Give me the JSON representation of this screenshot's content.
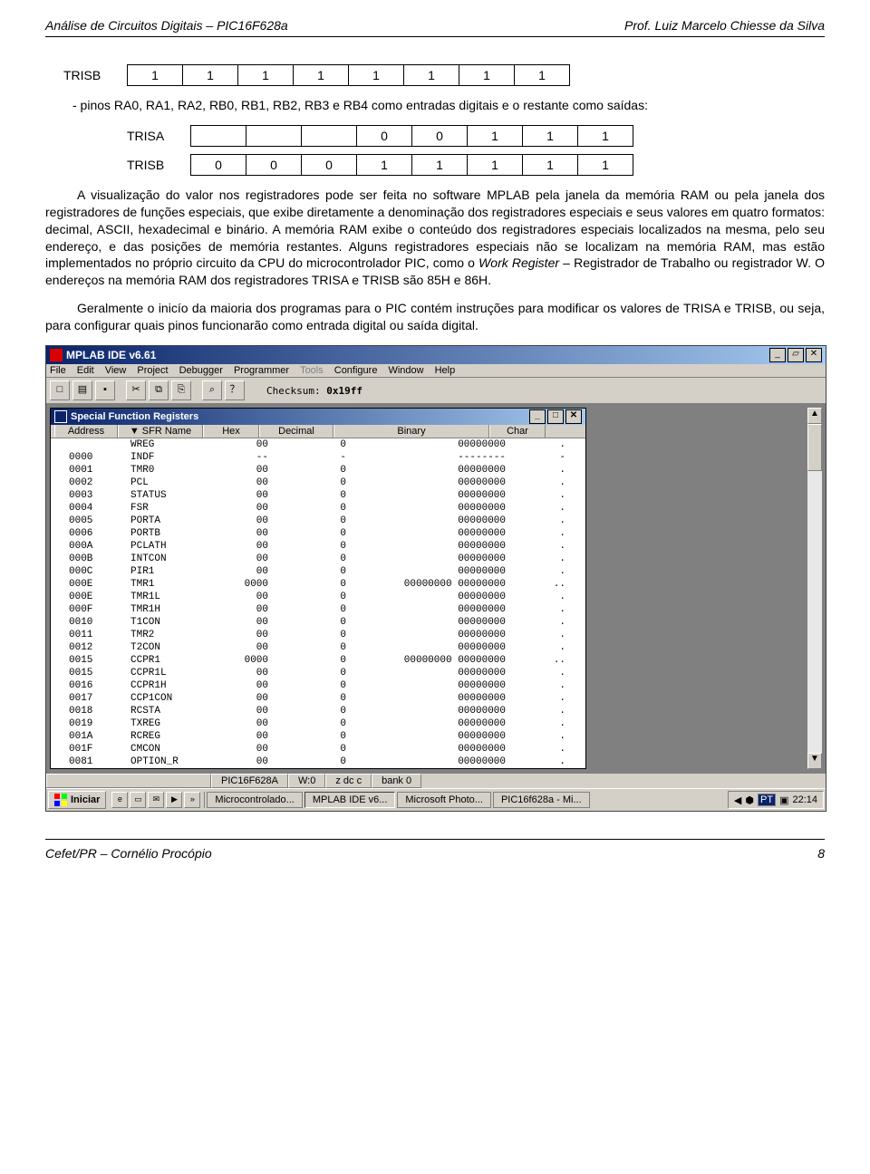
{
  "header": {
    "left": "Análise de Circuitos Digitais – PIC16F628a",
    "right": "Prof. Luiz Marcelo Chiesse da Silva"
  },
  "registers": {
    "trisb1_label": "TRISB",
    "trisb1_cells": [
      "1",
      "1",
      "1",
      "1",
      "1",
      "1",
      "1",
      "1"
    ],
    "trisa_label": "TRISA",
    "trisa_cells": [
      "",
      "",
      "",
      "0",
      "0",
      "1",
      "1",
      "1"
    ],
    "trisb2_label": "TRISB",
    "trisb2_cells": [
      "0",
      "0",
      "0",
      "1",
      "1",
      "1",
      "1",
      "1"
    ]
  },
  "body": {
    "p1": "- pinos RA0, RA1, RA2, RB0, RB1, RB2, RB3 e RB4 como entradas digitais e o restante como saídas:",
    "p2a": "A visualização do valor nos registradores pode ser feita no software MPLAB pela janela da memória RAM ou pela janela dos registradores de funções especiais, que exibe diretamente a denominação dos registradores especiais e seus valores em quatro formatos: decimal, ASCII, hexadecimal e binário. A memória RAM exibe o conteúdo dos registradores especiais localizados na mesma, pelo seu endereço, e das posições de memória restantes. Alguns registradores especiais não se localizam na memória RAM, mas estão implementados no próprio circuito da CPU do microcontrolador PIC, como o ",
    "p2_work": "Work Register",
    "p2b": " – Registrador de Trabalho ou registrador W. O endereços na memória RAM dos registradores TRISA e TRISB são 85H e 86H.",
    "p3": "Geralmente o inicío da maioria dos programas para o PIC contém instruções para modificar os valores de TRISA e TRISB, ou seja, para configurar quais pinos funcionarão como entrada digital ou saída digital."
  },
  "mplab": {
    "title": "MPLAB IDE v6.61",
    "menus": [
      "File",
      "Edit",
      "View",
      "Project",
      "Debugger",
      "Programmer",
      "Tools",
      "Configure",
      "Window",
      "Help"
    ],
    "menu_disabled_index": 7,
    "toolbar_icons": [
      "□",
      "▤",
      "▪",
      "✂",
      "⧉",
      "⎘",
      "⌕",
      "？"
    ],
    "checksum_label": "Checksum:",
    "checksum_value": "0x19ff",
    "sfr_title": "Special Function Registers",
    "sfr_headers": [
      "Address",
      "SFR Name",
      "Hex",
      "Decimal",
      "Binary",
      "Char"
    ],
    "sfr_rows": [
      {
        "addr": "",
        "name": "WREG",
        "hex": "00",
        "dec": "0",
        "bin": "00000000",
        "char": "."
      },
      {
        "addr": "0000",
        "name": "INDF",
        "hex": "--",
        "dec": "-",
        "bin": "--------",
        "char": "-"
      },
      {
        "addr": "0001",
        "name": "TMR0",
        "hex": "00",
        "dec": "0",
        "bin": "00000000",
        "char": "."
      },
      {
        "addr": "0002",
        "name": "PCL",
        "hex": "00",
        "dec": "0",
        "bin": "00000000",
        "char": "."
      },
      {
        "addr": "0003",
        "name": "STATUS",
        "hex": "00",
        "dec": "0",
        "bin": "00000000",
        "char": "."
      },
      {
        "addr": "0004",
        "name": "FSR",
        "hex": "00",
        "dec": "0",
        "bin": "00000000",
        "char": "."
      },
      {
        "addr": "0005",
        "name": "PORTA",
        "hex": "00",
        "dec": "0",
        "bin": "00000000",
        "char": "."
      },
      {
        "addr": "0006",
        "name": "PORTB",
        "hex": "00",
        "dec": "0",
        "bin": "00000000",
        "char": "."
      },
      {
        "addr": "000A",
        "name": "PCLATH",
        "hex": "00",
        "dec": "0",
        "bin": "00000000",
        "char": "."
      },
      {
        "addr": "000B",
        "name": "INTCON",
        "hex": "00",
        "dec": "0",
        "bin": "00000000",
        "char": "."
      },
      {
        "addr": "000C",
        "name": "PIR1",
        "hex": "00",
        "dec": "0",
        "bin": "00000000",
        "char": "."
      },
      {
        "addr": "000E",
        "name": "TMR1",
        "hex": "0000",
        "dec": "0",
        "bin": "00000000 00000000",
        "char": ".."
      },
      {
        "addr": "000E",
        "name": "TMR1L",
        "hex": "00",
        "dec": "0",
        "bin": "00000000",
        "char": "."
      },
      {
        "addr": "000F",
        "name": "TMR1H",
        "hex": "00",
        "dec": "0",
        "bin": "00000000",
        "char": "."
      },
      {
        "addr": "0010",
        "name": "T1CON",
        "hex": "00",
        "dec": "0",
        "bin": "00000000",
        "char": "."
      },
      {
        "addr": "0011",
        "name": "TMR2",
        "hex": "00",
        "dec": "0",
        "bin": "00000000",
        "char": "."
      },
      {
        "addr": "0012",
        "name": "T2CON",
        "hex": "00",
        "dec": "0",
        "bin": "00000000",
        "char": "."
      },
      {
        "addr": "0015",
        "name": "CCPR1",
        "hex": "0000",
        "dec": "0",
        "bin": "00000000 00000000",
        "char": ".."
      },
      {
        "addr": "0015",
        "name": "CCPR1L",
        "hex": "00",
        "dec": "0",
        "bin": "00000000",
        "char": "."
      },
      {
        "addr": "0016",
        "name": "CCPR1H",
        "hex": "00",
        "dec": "0",
        "bin": "00000000",
        "char": "."
      },
      {
        "addr": "0017",
        "name": "CCP1CON",
        "hex": "00",
        "dec": "0",
        "bin": "00000000",
        "char": "."
      },
      {
        "addr": "0018",
        "name": "RCSTA",
        "hex": "00",
        "dec": "0",
        "bin": "00000000",
        "char": "."
      },
      {
        "addr": "0019",
        "name": "TXREG",
        "hex": "00",
        "dec": "0",
        "bin": "00000000",
        "char": "."
      },
      {
        "addr": "001A",
        "name": "RCREG",
        "hex": "00",
        "dec": "0",
        "bin": "00000000",
        "char": "."
      },
      {
        "addr": "001F",
        "name": "CMCON",
        "hex": "00",
        "dec": "0",
        "bin": "00000000",
        "char": "."
      },
      {
        "addr": "0081",
        "name": "OPTION_R",
        "hex": "00",
        "dec": "0",
        "bin": "00000000",
        "char": "."
      }
    ],
    "status": {
      "chip": "PIC16F628A",
      "w": "W:0",
      "zdc": "z dc c",
      "bank": "bank 0"
    },
    "taskbar": {
      "start": "Iniciar",
      "tasks": [
        {
          "label": "Microcontrolado...",
          "active": false
        },
        {
          "label": "MPLAB IDE v6...",
          "active": true
        },
        {
          "label": "Microsoft Photo...",
          "active": false
        },
        {
          "label": "PIC16f628a - Mi...",
          "active": false
        }
      ],
      "tray_lang": "PT",
      "clock": "22:14"
    }
  },
  "footer": {
    "left": "Cefet/PR – Cornélio Procópio",
    "right": "8"
  }
}
